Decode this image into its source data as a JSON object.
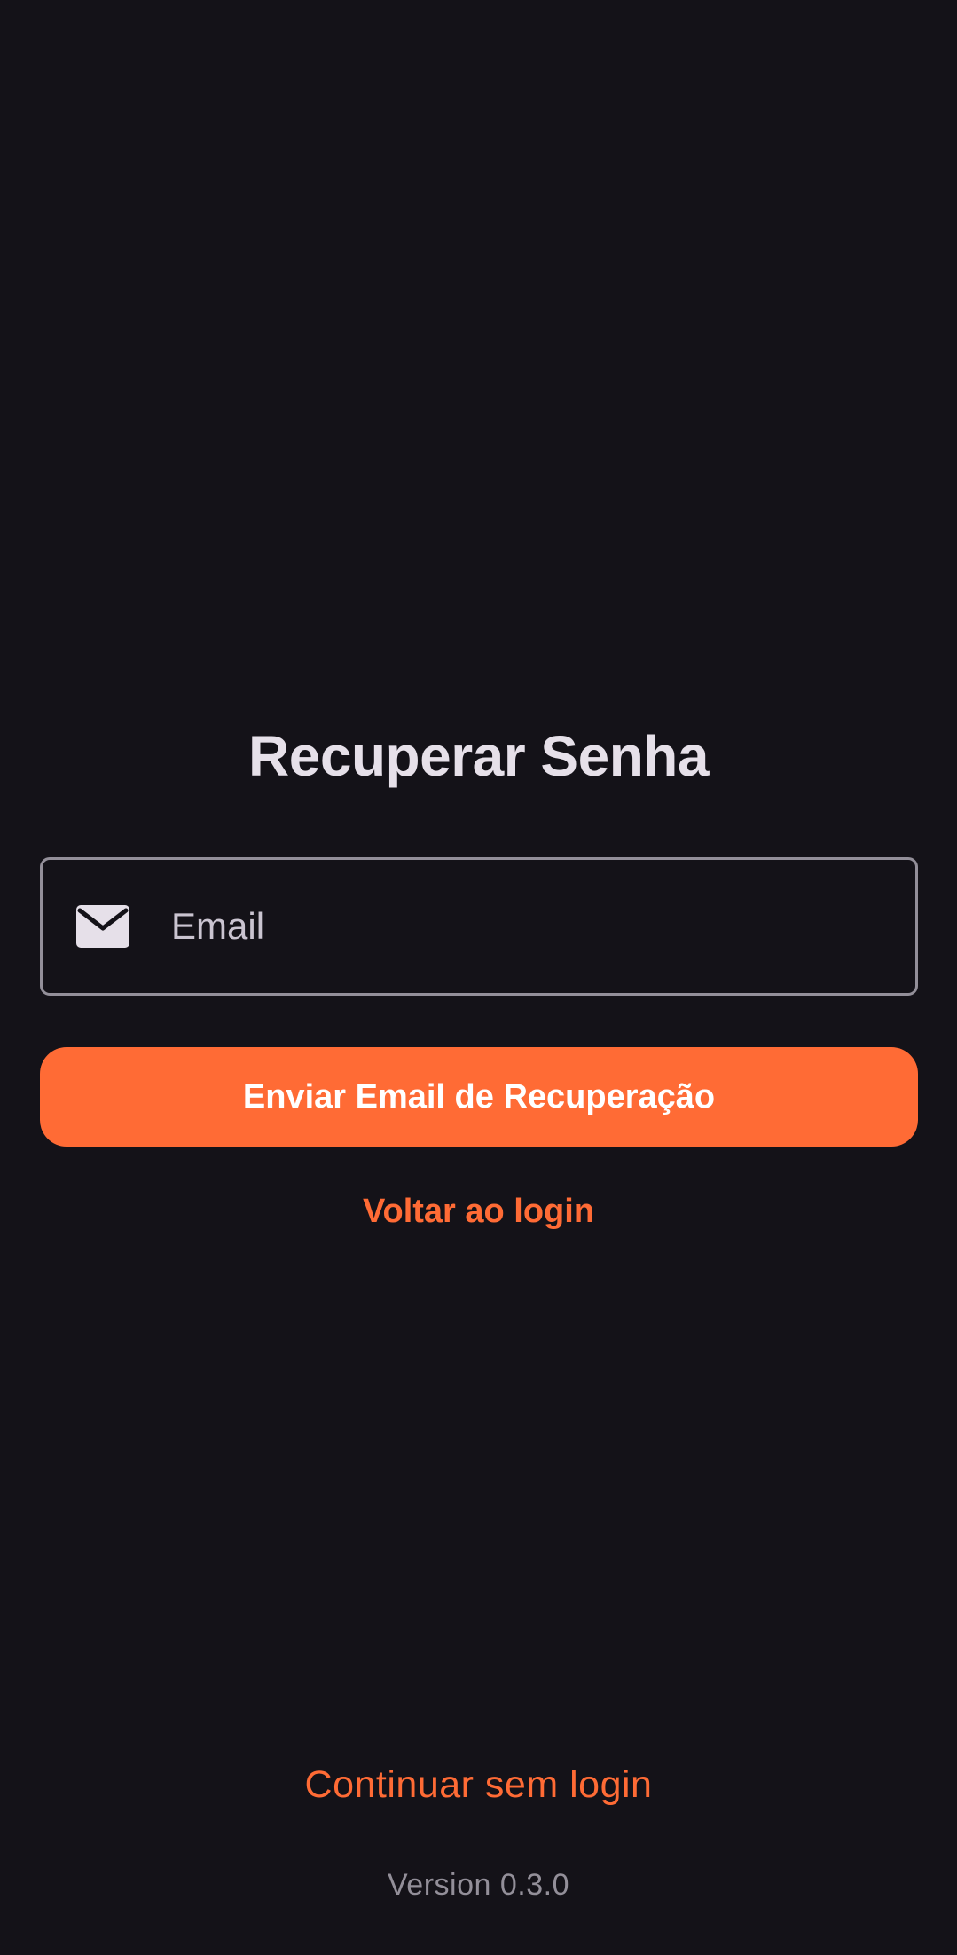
{
  "page": {
    "title": "Recuperar Senha"
  },
  "email_field": {
    "placeholder": "Email",
    "value": "",
    "icon": "mail-icon"
  },
  "actions": {
    "send_recovery_label": "Enviar Email de Recuperação",
    "back_to_login_label": "Voltar ao login",
    "continue_without_login_label": "Continuar sem login"
  },
  "footer": {
    "version_text": "Version 0.3.0"
  },
  "colors": {
    "background": "#141218",
    "accent": "#FF6B35",
    "title_text": "#E6E0E9",
    "field_border": "#938F99",
    "muted_text": "#938F99"
  }
}
